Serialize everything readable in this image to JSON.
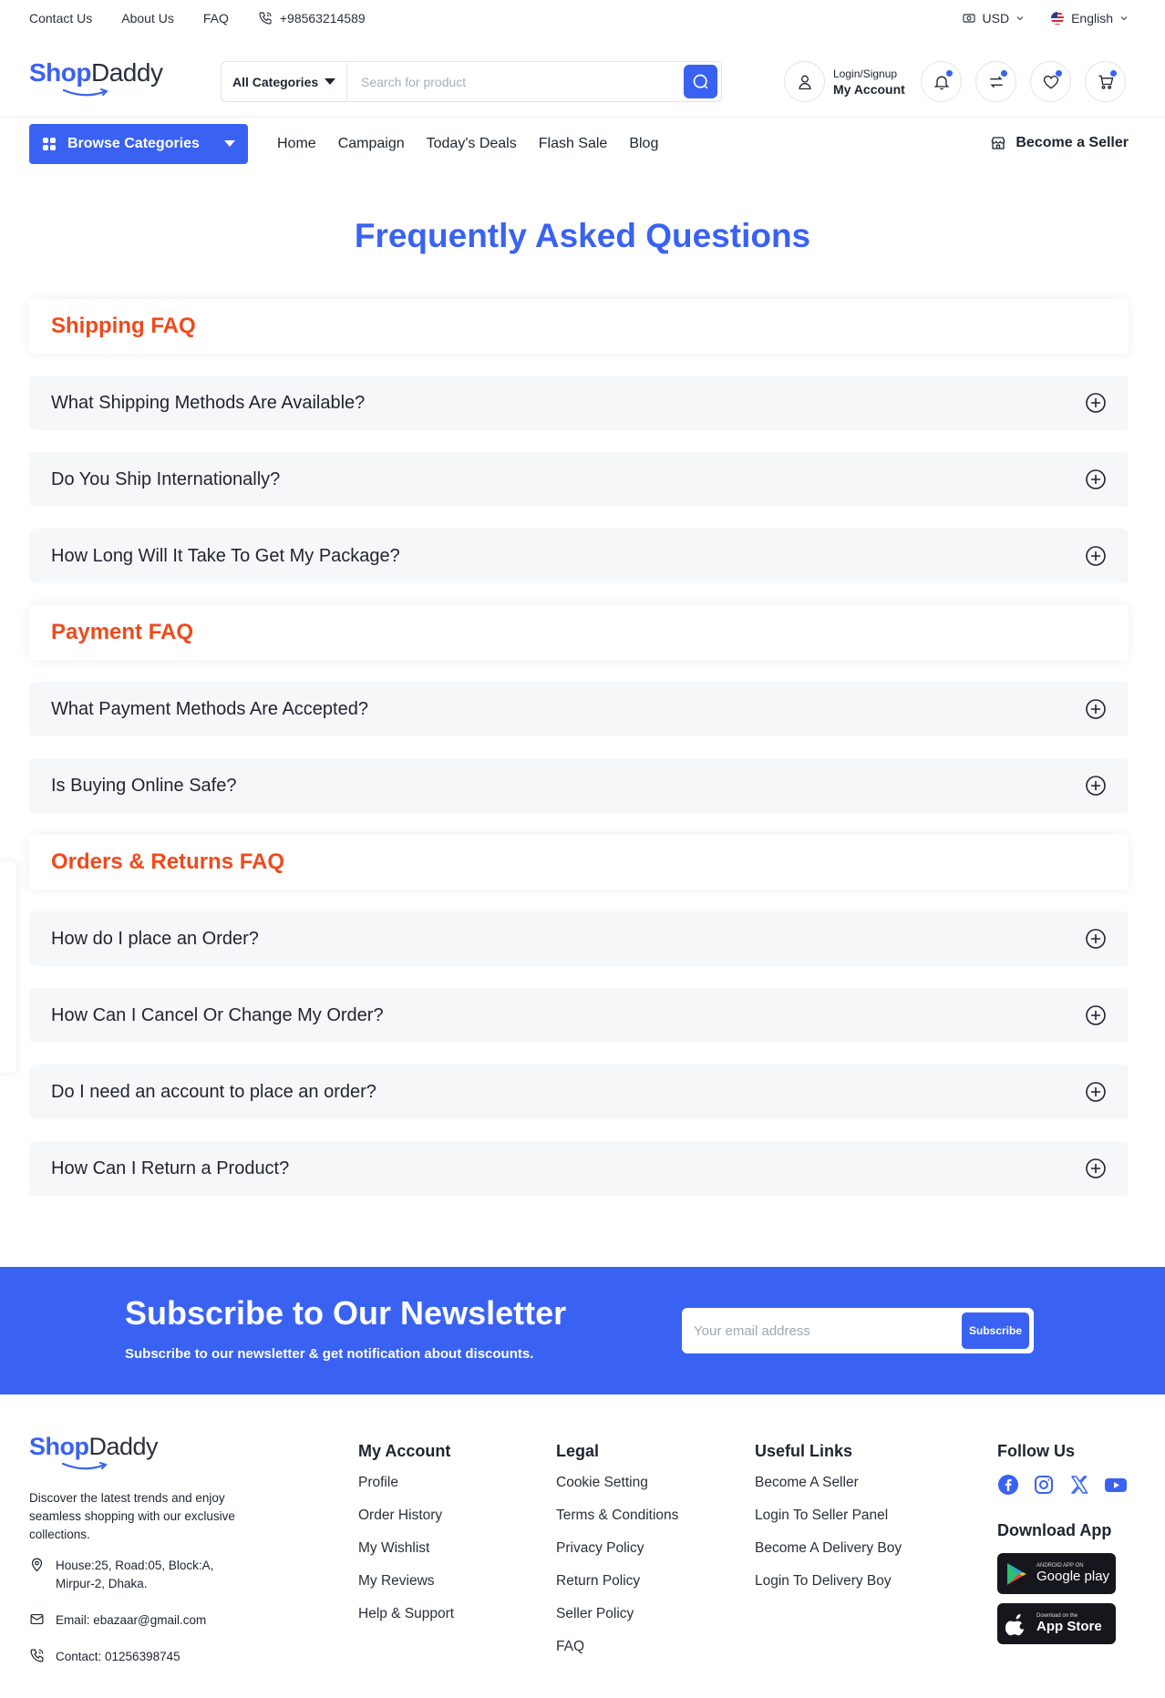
{
  "topbar": {
    "links": [
      "Contact Us",
      "About Us",
      "FAQ"
    ],
    "phone": "+98563214589",
    "currency": "USD",
    "language": "English"
  },
  "header": {
    "logo_shop": "Shop",
    "logo_daddy": "Daddy",
    "category_select": "All Categories",
    "search_placeholder": "Search for product",
    "account_line1": "Login/Signup",
    "account_line2": "My Account"
  },
  "nav": {
    "browse_label": "Browse Categories",
    "links": [
      "Home",
      "Campaign",
      "Today's Deals",
      "Flash Sale",
      "Blog"
    ],
    "seller_label": "Become a Seller"
  },
  "faq": {
    "title": "Frequently Asked Questions",
    "sections": [
      {
        "heading": "Shipping FAQ",
        "questions": [
          "What Shipping Methods Are Available?",
          "Do You Ship Internationally?",
          "How Long Will It Take To Get My Package?"
        ]
      },
      {
        "heading": "Payment FAQ",
        "questions": [
          "What Payment Methods Are Accepted?",
          "Is Buying Online Safe?"
        ]
      },
      {
        "heading": "Orders & Returns FAQ",
        "questions": [
          "How do I place an Order?",
          "How Can I Cancel Or Change My Order?",
          "Do I need an account to place an order?",
          "How Can I Return a Product?"
        ]
      }
    ]
  },
  "newsletter": {
    "title": "Subscribe to Our Newsletter",
    "subtitle": "Subscribe to our newsletter & get notification about discounts.",
    "email_placeholder": "Your email address",
    "button": "Subscribe"
  },
  "footer": {
    "description": "Discover the latest trends and enjoy seamless shopping with our exclusive collections.",
    "address": "House:25, Road:05, Block:A, Mirpur-2, Dhaka.",
    "email": "Email: ebazaar@gmail.com",
    "contact": "Contact: 01256398745",
    "my_account": {
      "title": "My Account",
      "links": [
        "Profile",
        "Order History",
        "My Wishlist",
        "My Reviews",
        "Help & Support"
      ]
    },
    "legal": {
      "title": "Legal",
      "links": [
        "Cookie Setting",
        "Terms & Conditions",
        "Privacy Policy",
        "Return Policy",
        "Seller Policy",
        "FAQ"
      ]
    },
    "useful_links": {
      "title": "Useful Links",
      "links": [
        "Become A Seller",
        "Login To Seller Panel",
        "Become A Delivery Boy",
        "Login To Delivery Boy"
      ]
    },
    "follow_title": "Follow Us",
    "download_title": "Download App",
    "google_small": "ANDROID APP ON",
    "google_big": "Google play",
    "apple_small": "Download on the",
    "apple_big": "App Store"
  },
  "colors": {
    "primary": "#3a62f2",
    "section_heading": "#ef4a1c",
    "faq_item_bg": "#f6f7f9"
  }
}
